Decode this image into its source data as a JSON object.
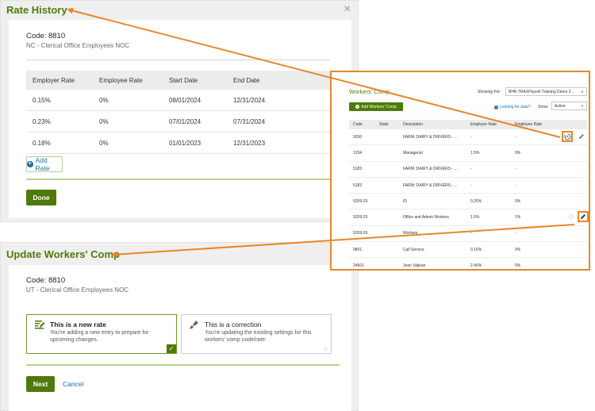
{
  "rate_history": {
    "title": "Rate History",
    "close_symbol": "×",
    "code_label": "Code: 8810",
    "code_description": "NC - Clerical Office Employees NOC",
    "columns": [
      "Employer Rate",
      "Employee Rate",
      "Start Date",
      "End Date"
    ],
    "rows": [
      [
        "0.15%",
        "0%",
        "08/01/2024",
        "12/31/2024"
      ],
      [
        "0.23%",
        "0%",
        "07/01/2024",
        "07/31/2024"
      ],
      [
        "0.18%",
        "0%",
        "01/01/2023",
        "12/31/2023"
      ]
    ],
    "add_rate_label": "Add Rate",
    "done_label": "Done"
  },
  "update_wc": {
    "title": "Update Workers' Comp",
    "code_label": "Code: 8810",
    "code_description": "UT - Clerical Office Employees NOC",
    "option_new_title": "This is a new rate",
    "option_new_desc": "You're adding a new entry to prepare for upcoming changes.",
    "option_correction_title": "This is a correction",
    "option_correction_desc": "You're updating the existing settings for this workers' comp code/rate.",
    "next_label": "Next",
    "cancel_label": "Cancel"
  },
  "workers_comp_panel": {
    "title": "Workers' Comp",
    "showing_for_label": "Showing For:",
    "showing_for_value": "BHR TRAXPayroll Training Demo 2...",
    "add_button_label": "Add Workers' Comp",
    "help_link": "Looking for data?",
    "show_label": "Show",
    "show_value": "Active",
    "columns": [
      "Code",
      "State",
      "Description",
      "Employer Rate",
      "Employee Rate"
    ],
    "rows": [
      {
        "code": "0036",
        "state": "",
        "description": "FARM: DAIRY & DRIVERS - ...",
        "employer_rate": "-",
        "employee_rate": "-"
      },
      {
        "code": "1234",
        "state": "",
        "description": "Managerial",
        "employer_rate": "1.5%",
        "employee_rate": "0%"
      },
      {
        "code": "5183",
        "state": "",
        "description": "FARM: DAIRY & DRIVERS - ...",
        "employer_rate": "-",
        "employee_rate": "-"
      },
      {
        "code": "5183",
        "state": "",
        "description": "FARM: DAIRY & DRIVERS - ...",
        "employer_rate": "-",
        "employee_rate": "-"
      },
      {
        "code": "5209-25",
        "state": "",
        "description": "ID",
        "employer_rate": "0.25%",
        "employee_rate": "0%"
      },
      {
        "code": "5209-25",
        "state": "",
        "description": "Office and Admin Workers",
        "employer_rate": "1.5%",
        "employee_rate": "1%"
      },
      {
        "code": "5209-26",
        "state": "",
        "description": "Workers",
        "employer_rate": "-",
        "employee_rate": "-"
      },
      {
        "code": "9801",
        "state": "",
        "description": "Call Service",
        "employer_rate": "0.16%",
        "employee_rate": "0%"
      },
      {
        "code": "24601",
        "state": "",
        "description": "Jean Valjean",
        "employer_rate": "2.46%",
        "employee_rate": "0%"
      }
    ]
  },
  "colors": {
    "brand_green": "#4f7a0a",
    "link_blue": "#1b6fb3",
    "highlight_orange": "#e8862a"
  }
}
